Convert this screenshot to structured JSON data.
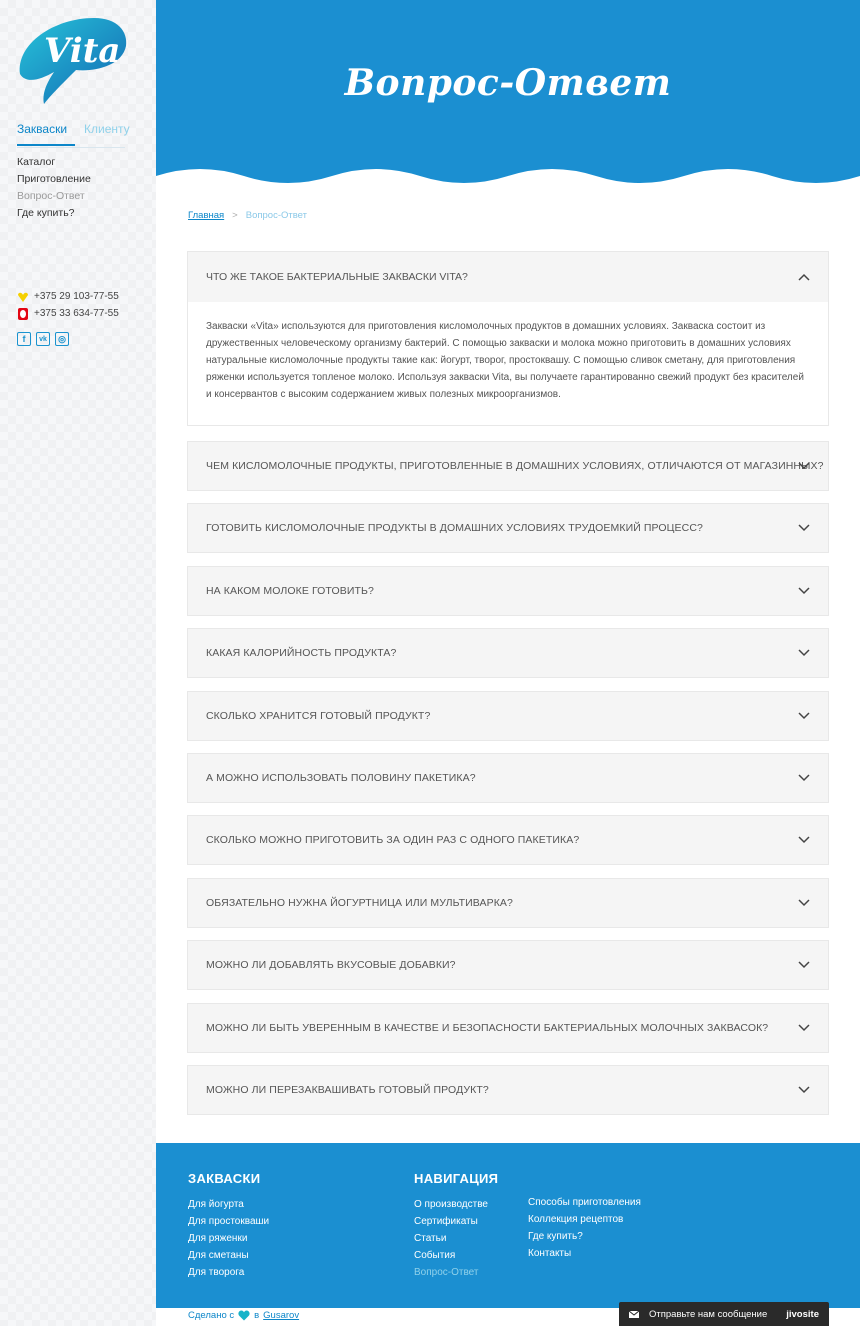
{
  "sidebar": {
    "logo_text": "Vita",
    "tabs": [
      {
        "label": "Закваски"
      },
      {
        "label": "Клиенту"
      }
    ],
    "menu": [
      {
        "label": "Каталог"
      },
      {
        "label": "Приготовление"
      },
      {
        "label": "Вопрос-Ответ"
      },
      {
        "label": "Где купить?"
      }
    ],
    "phones": [
      {
        "number": "+375 29 103-77-55",
        "icon": "velcom-icon",
        "color": "#f5d000"
      },
      {
        "number": "+375 33 634-77-55",
        "icon": "mts-icon",
        "color": "#e30613"
      }
    ],
    "socials": [
      {
        "label": "f",
        "icon": "facebook-icon"
      },
      {
        "label": "vk",
        "icon": "vk-icon"
      },
      {
        "label": "◎",
        "icon": "instagram-icon"
      }
    ]
  },
  "header": {
    "title": "Вопрос-Ответ",
    "color": "#1b8fd1"
  },
  "breadcrumb": {
    "home": "Главная",
    "separator": ">",
    "current": "Вопрос-Ответ"
  },
  "faq": {
    "open": {
      "question": "Что же такое бактериальные закваски VITA?",
      "answer": "Закваски «Vita» используются для приготовления кисломолочных продуктов в домашних условиях. Закваска состоит из дружественных человеческому организму бактерий. С помощью закваски и молока можно приготовить в домашних условиях натуральные кисломолочные продукты такие как: йогурт, творог, простоквашу. С помощью сливок сметану, для приготовления ряженки используется топленое молоко. Используя закваски Vita, вы получаете гарантированно свежий продукт без красителей и консервантов с высоким содержанием живых полезных микроорганизмов."
    },
    "items": [
      {
        "question": "Чем кисломолочные продукты, приготовленные в домашних условиях, отличаются от магазинных?"
      },
      {
        "question": "Готовить кисломолочные продукты в домашних условиях трудоемкий процесс?"
      },
      {
        "question": "На каком молоке готовить?"
      },
      {
        "question": "Какая калорийность продукта?"
      },
      {
        "question": "Сколько хранится готовый продукт?"
      },
      {
        "question": "А можно использовать половину пакетика?"
      },
      {
        "question": "Сколько можно приготовить за один раз с одного пакетика?"
      },
      {
        "question": "Обязательно нужна йогуртница или мультиварка?"
      },
      {
        "question": "Можно ли добавлять вкусовые добавки?"
      },
      {
        "question": "Можно ли быть уверенным в качестве и безопасности бактериальных молочных заквасок?"
      },
      {
        "question": "Можно ли перезаквашивать готовый продукт?"
      }
    ]
  },
  "footer": {
    "col1": {
      "title": "ЗАКВАСКИ",
      "links": [
        "Для йогурта",
        "Для простокваши",
        "Для ряженки",
        "Для сметаны",
        "Для творога"
      ]
    },
    "col2": {
      "title": "НАВИГАЦИЯ",
      "links": [
        "О производстве",
        "Сертификаты",
        "Статьи",
        "События",
        "Вопрос-Ответ"
      ]
    },
    "col3": {
      "links": [
        "Способы приготовления",
        "Коллекция рецептов",
        "Где купить?",
        "Контакты"
      ]
    }
  },
  "credits": {
    "prefix": "Сделано с",
    "middle": "в",
    "author": "Gusarov"
  },
  "chat_widget": {
    "label": "Отправьте нам сообщение",
    "brand": "jivosite"
  }
}
